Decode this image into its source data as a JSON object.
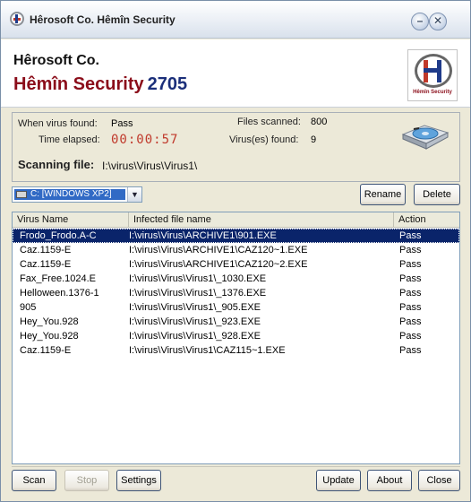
{
  "window": {
    "title": "Hêrosoft Co. Hêmîn Security",
    "minimize_glyph": "–",
    "close_glyph": "✕"
  },
  "header": {
    "company": "Hêrosoft Co.",
    "product": "Hêmîn Security",
    "build": "2705",
    "logo_caption": "Hêmîn Security"
  },
  "status": {
    "when_found_label": "When virus found:",
    "when_found_value": "Pass",
    "elapsed_label": "Time elapsed:",
    "elapsed_value": "00:00:57",
    "files_scanned_label": "Files scanned:",
    "files_scanned_value": "800",
    "viruses_found_label": "Virus(es) found:",
    "viruses_found_value": "9",
    "scanning_label": "Scanning file:",
    "scanning_value": "I:\\virus\\Virus\\Virus1\\"
  },
  "drive": {
    "selected": "C: [WINDOWS XP2]",
    "arrow": "▼"
  },
  "actions": {
    "rename": "Rename",
    "delete": "Delete"
  },
  "table": {
    "columns": [
      "Virus Name",
      "Infected file name",
      "Action"
    ],
    "rows": [
      {
        "virus": "Frodo_Frodo.A-C",
        "file": "I:\\virus\\Virus\\ARCHIVE1\\901.EXE",
        "action": "Pass"
      },
      {
        "virus": "Caz.1159-E",
        "file": "I:\\virus\\Virus\\ARCHIVE1\\CAZ120~1.EXE",
        "action": "Pass"
      },
      {
        "virus": "Caz.1159-E",
        "file": "I:\\virus\\Virus\\ARCHIVE1\\CAZ120~2.EXE",
        "action": "Pass"
      },
      {
        "virus": "Fax_Free.1024.E",
        "file": "I:\\virus\\Virus\\Virus1\\_1030.EXE",
        "action": "Pass"
      },
      {
        "virus": "Helloween.1376-1",
        "file": "I:\\virus\\Virus\\Virus1\\_1376.EXE",
        "action": "Pass"
      },
      {
        "virus": "905",
        "file": "I:\\virus\\Virus\\Virus1\\_905.EXE",
        "action": "Pass"
      },
      {
        "virus": "Hey_You.928",
        "file": "I:\\virus\\Virus\\Virus1\\_923.EXE",
        "action": "Pass"
      },
      {
        "virus": "Hey_You.928",
        "file": "I:\\virus\\Virus\\Virus1\\_928.EXE",
        "action": "Pass"
      },
      {
        "virus": "Caz.1159-E",
        "file": "I:\\virus\\Virus\\Virus1\\CAZ115~1.EXE",
        "action": "Pass"
      }
    ]
  },
  "footer": {
    "scan": "Scan",
    "stop": "Stop",
    "settings": "Settings",
    "update": "Update",
    "about": "About",
    "close": "Close"
  }
}
